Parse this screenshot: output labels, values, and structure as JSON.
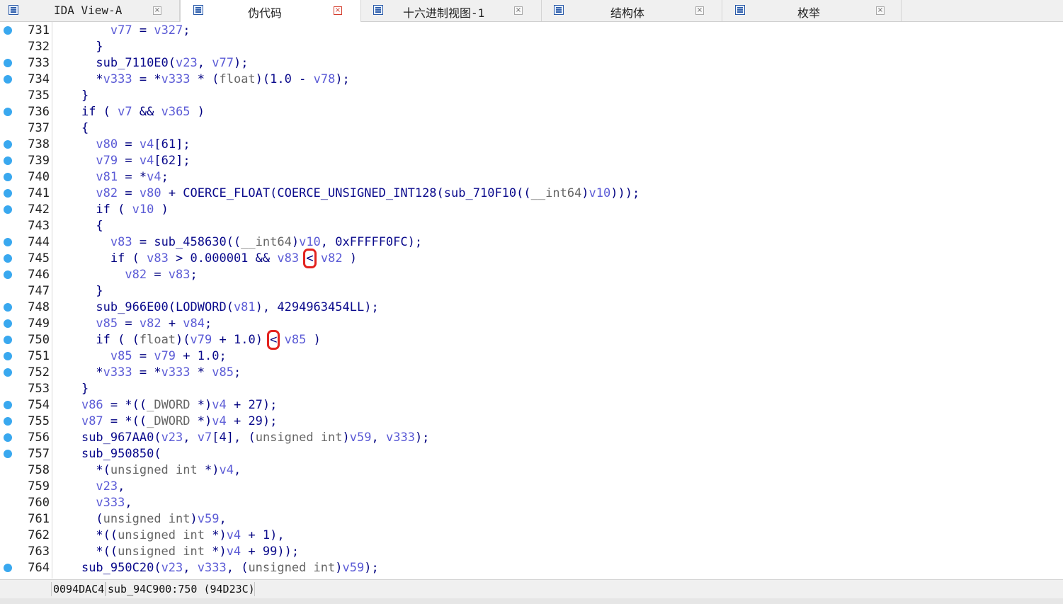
{
  "tabs": [
    {
      "label": "IDA View-A",
      "icon": "disassembly-view-icon",
      "active": false
    },
    {
      "label": "伪代码",
      "icon": "pseudocode-icon",
      "active": true
    },
    {
      "label": "十六进制视图-1",
      "icon": "hex-view-icon",
      "active": false
    },
    {
      "label": "结构体",
      "icon": "structures-icon",
      "active": false
    },
    {
      "label": "枚举",
      "icon": "enums-icon",
      "active": false
    }
  ],
  "close_glyph": "×",
  "code_lines": [
    {
      "n": "731",
      "bp": true,
      "indent": "        ",
      "tokens": [
        [
          "v",
          "v77"
        ],
        [
          "p",
          " = "
        ],
        [
          "v",
          "v327"
        ],
        [
          "p",
          ";"
        ]
      ]
    },
    {
      "n": "732",
      "bp": false,
      "indent": "      ",
      "tokens": [
        [
          "p",
          "}"
        ]
      ]
    },
    {
      "n": "733",
      "bp": true,
      "indent": "      ",
      "tokens": [
        [
          "f",
          "sub_7110E0"
        ],
        [
          "p",
          "("
        ],
        [
          "v",
          "v23"
        ],
        [
          "p",
          ", "
        ],
        [
          "v",
          "v77"
        ],
        [
          "p",
          ");"
        ]
      ]
    },
    {
      "n": "734",
      "bp": true,
      "indent": "      ",
      "tokens": [
        [
          "p",
          "*"
        ],
        [
          "v",
          "v333"
        ],
        [
          "p",
          " = *"
        ],
        [
          "v",
          "v333"
        ],
        [
          "p",
          " * ("
        ],
        [
          "t",
          "float"
        ],
        [
          "p",
          ")("
        ],
        [
          "n",
          "1.0"
        ],
        [
          "p",
          " - "
        ],
        [
          "v",
          "v78"
        ],
        [
          "p",
          ");"
        ]
      ]
    },
    {
      "n": "735",
      "bp": false,
      "indent": "    ",
      "tokens": [
        [
          "p",
          "}"
        ]
      ]
    },
    {
      "n": "736",
      "bp": true,
      "indent": "    ",
      "tokens": [
        [
          "k",
          "if"
        ],
        [
          "p",
          " ( "
        ],
        [
          "v",
          "v7"
        ],
        [
          "p",
          " && "
        ],
        [
          "v",
          "v365"
        ],
        [
          "p",
          " )"
        ]
      ]
    },
    {
      "n": "737",
      "bp": false,
      "indent": "    ",
      "tokens": [
        [
          "p",
          "{"
        ]
      ]
    },
    {
      "n": "738",
      "bp": true,
      "indent": "      ",
      "tokens": [
        [
          "v",
          "v80"
        ],
        [
          "p",
          " = "
        ],
        [
          "v",
          "v4"
        ],
        [
          "p",
          "["
        ],
        [
          "n",
          "61"
        ],
        [
          "p",
          "];"
        ]
      ]
    },
    {
      "n": "739",
      "bp": true,
      "indent": "      ",
      "tokens": [
        [
          "v",
          "v79"
        ],
        [
          "p",
          " = "
        ],
        [
          "v",
          "v4"
        ],
        [
          "p",
          "["
        ],
        [
          "n",
          "62"
        ],
        [
          "p",
          "];"
        ]
      ]
    },
    {
      "n": "740",
      "bp": true,
      "indent": "      ",
      "tokens": [
        [
          "v",
          "v81"
        ],
        [
          "p",
          " = *"
        ],
        [
          "v",
          "v4"
        ],
        [
          "p",
          ";"
        ]
      ]
    },
    {
      "n": "741",
      "bp": true,
      "indent": "      ",
      "tokens": [
        [
          "v",
          "v82"
        ],
        [
          "p",
          " = "
        ],
        [
          "v",
          "v80"
        ],
        [
          "p",
          " + "
        ],
        [
          "f",
          "COERCE_FLOAT"
        ],
        [
          "p",
          "("
        ],
        [
          "f",
          "COERCE_UNSIGNED_INT128"
        ],
        [
          "p",
          "("
        ],
        [
          "f",
          "sub_710F10"
        ],
        [
          "p",
          "(("
        ],
        [
          "t",
          "__int64"
        ],
        [
          "p",
          ")"
        ],
        [
          "v",
          "v10"
        ],
        [
          "p",
          ")));"
        ]
      ]
    },
    {
      "n": "742",
      "bp": true,
      "indent": "      ",
      "tokens": [
        [
          "k",
          "if"
        ],
        [
          "p",
          " ( "
        ],
        [
          "v",
          "v10"
        ],
        [
          "p",
          " )"
        ]
      ]
    },
    {
      "n": "743",
      "bp": false,
      "indent": "      ",
      "tokens": [
        [
          "p",
          "{"
        ]
      ]
    },
    {
      "n": "744",
      "bp": true,
      "indent": "        ",
      "tokens": [
        [
          "v",
          "v83"
        ],
        [
          "p",
          " = "
        ],
        [
          "f",
          "sub_458630"
        ],
        [
          "p",
          "(("
        ],
        [
          "t",
          "__int64"
        ],
        [
          "p",
          ")"
        ],
        [
          "v",
          "v10"
        ],
        [
          "p",
          ", "
        ],
        [
          "n",
          "0xFFFFF0FC"
        ],
        [
          "p",
          ");"
        ]
      ]
    },
    {
      "n": "745",
      "bp": true,
      "indent": "        ",
      "tokens": [
        [
          "k",
          "if"
        ],
        [
          "p",
          " ( "
        ],
        [
          "v",
          "v83"
        ],
        [
          "p",
          " > "
        ],
        [
          "n",
          "0.000001"
        ],
        [
          "p",
          " && "
        ],
        [
          "v",
          "v83"
        ],
        [
          "p",
          " "
        ],
        [
          "h",
          "<"
        ],
        [
          "p",
          " "
        ],
        [
          "v",
          "v82"
        ],
        [
          "p",
          " )"
        ]
      ]
    },
    {
      "n": "746",
      "bp": true,
      "indent": "          ",
      "tokens": [
        [
          "v",
          "v82"
        ],
        [
          "p",
          " = "
        ],
        [
          "v",
          "v83"
        ],
        [
          "p",
          ";"
        ]
      ]
    },
    {
      "n": "747",
      "bp": false,
      "indent": "      ",
      "tokens": [
        [
          "p",
          "}"
        ]
      ]
    },
    {
      "n": "748",
      "bp": true,
      "indent": "      ",
      "tokens": [
        [
          "f",
          "sub_966E00"
        ],
        [
          "p",
          "("
        ],
        [
          "f",
          "LODWORD"
        ],
        [
          "p",
          "("
        ],
        [
          "v",
          "v81"
        ],
        [
          "p",
          "), "
        ],
        [
          "n",
          "4294963454LL"
        ],
        [
          "p",
          ");"
        ]
      ]
    },
    {
      "n": "749",
      "bp": true,
      "indent": "      ",
      "tokens": [
        [
          "v",
          "v85"
        ],
        [
          "p",
          " = "
        ],
        [
          "v",
          "v82"
        ],
        [
          "p",
          " + "
        ],
        [
          "v",
          "v84"
        ],
        [
          "p",
          ";"
        ]
      ]
    },
    {
      "n": "750",
      "bp": true,
      "indent": "      ",
      "tokens": [
        [
          "k",
          "if"
        ],
        [
          "p",
          " ( ("
        ],
        [
          "t",
          "float"
        ],
        [
          "p",
          ")("
        ],
        [
          "v",
          "v79"
        ],
        [
          "p",
          " + "
        ],
        [
          "n",
          "1.0"
        ],
        [
          "p",
          ") "
        ],
        [
          "h",
          "<"
        ],
        [
          "p",
          " "
        ],
        [
          "v",
          "v85"
        ],
        [
          "p",
          " )"
        ]
      ]
    },
    {
      "n": "751",
      "bp": true,
      "indent": "        ",
      "tokens": [
        [
          "v",
          "v85"
        ],
        [
          "p",
          " = "
        ],
        [
          "v",
          "v79"
        ],
        [
          "p",
          " + "
        ],
        [
          "n",
          "1.0"
        ],
        [
          "p",
          ";"
        ]
      ]
    },
    {
      "n": "752",
      "bp": true,
      "indent": "      ",
      "tokens": [
        [
          "p",
          "*"
        ],
        [
          "v",
          "v333"
        ],
        [
          "p",
          " = *"
        ],
        [
          "v",
          "v333"
        ],
        [
          "p",
          " * "
        ],
        [
          "v",
          "v85"
        ],
        [
          "p",
          ";"
        ]
      ]
    },
    {
      "n": "753",
      "bp": false,
      "indent": "    ",
      "tokens": [
        [
          "p",
          "}"
        ]
      ]
    },
    {
      "n": "754",
      "bp": true,
      "indent": "    ",
      "tokens": [
        [
          "v",
          "v86"
        ],
        [
          "p",
          " = *(("
        ],
        [
          "t",
          "_DWORD"
        ],
        [
          "p",
          " *)"
        ],
        [
          "v",
          "v4"
        ],
        [
          "p",
          " + "
        ],
        [
          "n",
          "27"
        ],
        [
          "p",
          ");"
        ]
      ]
    },
    {
      "n": "755",
      "bp": true,
      "indent": "    ",
      "tokens": [
        [
          "v",
          "v87"
        ],
        [
          "p",
          " = *(("
        ],
        [
          "t",
          "_DWORD"
        ],
        [
          "p",
          " *)"
        ],
        [
          "v",
          "v4"
        ],
        [
          "p",
          " + "
        ],
        [
          "n",
          "29"
        ],
        [
          "p",
          ");"
        ]
      ]
    },
    {
      "n": "756",
      "bp": true,
      "indent": "    ",
      "tokens": [
        [
          "f",
          "sub_967AA0"
        ],
        [
          "p",
          "("
        ],
        [
          "v",
          "v23"
        ],
        [
          "p",
          ", "
        ],
        [
          "v",
          "v7"
        ],
        [
          "p",
          "["
        ],
        [
          "n",
          "4"
        ],
        [
          "p",
          "], ("
        ],
        [
          "t",
          "unsigned int"
        ],
        [
          "p",
          ")"
        ],
        [
          "v",
          "v59"
        ],
        [
          "p",
          ", "
        ],
        [
          "v",
          "v333"
        ],
        [
          "p",
          ");"
        ]
      ]
    },
    {
      "n": "757",
      "bp": true,
      "indent": "    ",
      "tokens": [
        [
          "f",
          "sub_950850"
        ],
        [
          "p",
          "("
        ]
      ]
    },
    {
      "n": "758",
      "bp": false,
      "indent": "      ",
      "tokens": [
        [
          "p",
          "*("
        ],
        [
          "t",
          "unsigned int"
        ],
        [
          "p",
          " *)"
        ],
        [
          "v",
          "v4"
        ],
        [
          "p",
          ","
        ]
      ]
    },
    {
      "n": "759",
      "bp": false,
      "indent": "      ",
      "tokens": [
        [
          "v",
          "v23"
        ],
        [
          "p",
          ","
        ]
      ]
    },
    {
      "n": "760",
      "bp": false,
      "indent": "      ",
      "tokens": [
        [
          "v",
          "v333"
        ],
        [
          "p",
          ","
        ]
      ]
    },
    {
      "n": "761",
      "bp": false,
      "indent": "      ",
      "tokens": [
        [
          "p",
          "("
        ],
        [
          "t",
          "unsigned int"
        ],
        [
          "p",
          ")"
        ],
        [
          "v",
          "v59"
        ],
        [
          "p",
          ","
        ]
      ]
    },
    {
      "n": "762",
      "bp": false,
      "indent": "      ",
      "tokens": [
        [
          "p",
          "*(("
        ],
        [
          "t",
          "unsigned int"
        ],
        [
          "p",
          " *)"
        ],
        [
          "v",
          "v4"
        ],
        [
          "p",
          " + "
        ],
        [
          "n",
          "1"
        ],
        [
          "p",
          "),"
        ]
      ]
    },
    {
      "n": "763",
      "bp": false,
      "indent": "      ",
      "tokens": [
        [
          "p",
          "*(("
        ],
        [
          "t",
          "unsigned int"
        ],
        [
          "p",
          " *)"
        ],
        [
          "v",
          "v4"
        ],
        [
          "p",
          " + "
        ],
        [
          "n",
          "99"
        ],
        [
          "p",
          "));"
        ]
      ]
    },
    {
      "n": "764",
      "bp": true,
      "indent": "    ",
      "tokens": [
        [
          "f",
          "sub_950C20"
        ],
        [
          "p",
          "("
        ],
        [
          "v",
          "v23"
        ],
        [
          "p",
          ", "
        ],
        [
          "v",
          "v333"
        ],
        [
          "p",
          ", ("
        ],
        [
          "t",
          "unsigned int"
        ],
        [
          "p",
          ")"
        ],
        [
          "v",
          "v59"
        ],
        [
          "p",
          ");"
        ]
      ]
    }
  ],
  "status": {
    "address": "0094DAC4",
    "location": "sub_94C900:750 (94D23C)"
  }
}
